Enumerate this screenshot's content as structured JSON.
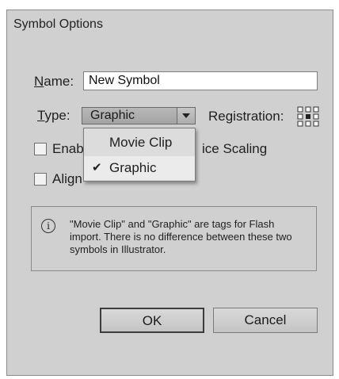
{
  "dialog": {
    "title": "Symbol Options",
    "name_label_first": "N",
    "name_label_rest": "ame:",
    "name_value": "New Symbol",
    "type_label_first": "T",
    "type_label_rest": "ype:",
    "type_selected": "Graphic",
    "registration_label": "Registration:",
    "enable_label_visible": "Enab",
    "enable_label_tail": "ice Scaling",
    "align_label_visible": "Align"
  },
  "dropdown": {
    "options": [
      {
        "label": "Movie Clip",
        "checked": false
      },
      {
        "label": "Graphic",
        "checked": true
      }
    ],
    "check_glyph": "✔"
  },
  "info": {
    "icon": "info-icon",
    "icon_glyph": "i",
    "text": "\"Movie Clip\" and \"Graphic\" are tags for Flash import. There is no difference between these two symbols in Illustrator."
  },
  "buttons": {
    "ok_label": "OK",
    "cancel_label": "Cancel"
  },
  "colors": {
    "dialog_bg": "#d0d0d0",
    "dropdown_bg": "#dcdcdc"
  }
}
